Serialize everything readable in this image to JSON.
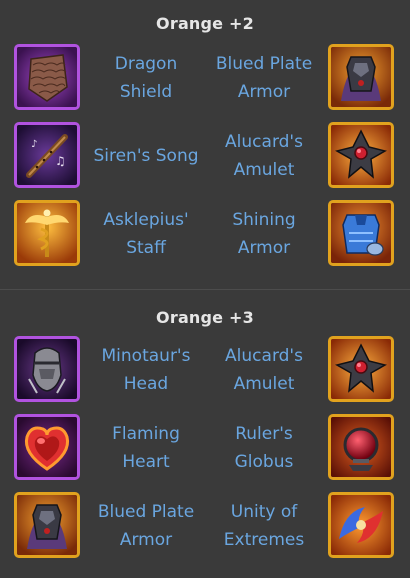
{
  "sections": [
    {
      "title": "Orange +2",
      "rows": [
        {
          "left": {
            "name": [
              "Dragon",
              "Shield"
            ],
            "icon": "dragon-shield-icon",
            "frame": "purple"
          },
          "right": {
            "name": [
              "Blued Plate",
              "Armor"
            ],
            "icon": "blued-plate-armor-icon",
            "frame": "gold"
          }
        },
        {
          "left": {
            "name": [
              "Siren's Song",
              ""
            ],
            "icon": "sirens-song-icon",
            "frame": "purple"
          },
          "right": {
            "name": [
              "Alucard's",
              "Amulet"
            ],
            "icon": "alucards-amulet-icon",
            "frame": "gold"
          }
        },
        {
          "left": {
            "name": [
              "Asklepius'",
              "Staff"
            ],
            "icon": "asklepius-staff-icon",
            "frame": "gold"
          },
          "right": {
            "name": [
              "Shining",
              "Armor"
            ],
            "icon": "shining-armor-icon",
            "frame": "gold"
          }
        }
      ]
    },
    {
      "title": "Orange +3",
      "rows": [
        {
          "left": {
            "name": [
              "Minotaur's",
              "Head"
            ],
            "icon": "minotaurs-head-icon",
            "frame": "purple"
          },
          "right": {
            "name": [
              "Alucard's",
              "Amulet"
            ],
            "icon": "alucards-amulet-icon",
            "frame": "gold"
          }
        },
        {
          "left": {
            "name": [
              "Flaming",
              "Heart"
            ],
            "icon": "flaming-heart-icon",
            "frame": "purple"
          },
          "right": {
            "name": [
              "Ruler's",
              "Globus"
            ],
            "icon": "rulers-globus-icon",
            "frame": "gold"
          }
        },
        {
          "left": {
            "name": [
              "Blued Plate",
              "Armor"
            ],
            "icon": "blued-plate-armor-icon",
            "frame": "gold"
          },
          "right": {
            "name": [
              "Unity of",
              "Extremes"
            ],
            "icon": "unity-of-extremes-icon",
            "frame": "gold"
          }
        }
      ]
    }
  ],
  "colors": {
    "background": "#3a3a3a",
    "heading": "#e6e6e6",
    "item_name": "#6aa6e0",
    "frame_purple": "#b153e0",
    "frame_gold": "#e1a21e"
  }
}
